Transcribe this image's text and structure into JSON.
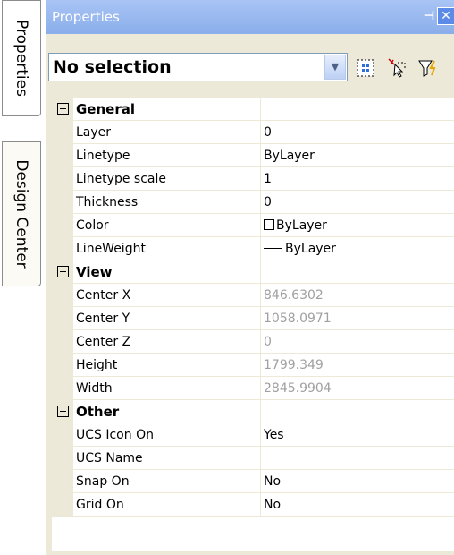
{
  "side_tabs": [
    "Properties",
    "Design Center"
  ],
  "panel": {
    "title": "Properties"
  },
  "toolbar": {
    "selection": "No selection"
  },
  "categories": [
    {
      "name": "General",
      "rows": [
        {
          "name": "Layer",
          "value": "0"
        },
        {
          "name": "Linetype",
          "value": "ByLayer"
        },
        {
          "name": "Linetype scale",
          "value": "1"
        },
        {
          "name": "Thickness",
          "value": "0"
        },
        {
          "name": "Color",
          "value": "ByLayer"
        },
        {
          "name": "LineWeight",
          "value": "ByLayer"
        }
      ]
    },
    {
      "name": "View",
      "rows": [
        {
          "name": "Center X",
          "value": "846.6302"
        },
        {
          "name": "Center Y",
          "value": "1058.0971"
        },
        {
          "name": "Center Z",
          "value": "0"
        },
        {
          "name": "Height",
          "value": "1799.349"
        },
        {
          "name": "Width",
          "value": "2845.9904"
        }
      ]
    },
    {
      "name": "Other",
      "rows": [
        {
          "name": "UCS Icon On",
          "value": "Yes"
        },
        {
          "name": "UCS Name",
          "value": ""
        },
        {
          "name": "Snap On",
          "value": "No"
        },
        {
          "name": "Grid On",
          "value": "No"
        }
      ]
    }
  ]
}
